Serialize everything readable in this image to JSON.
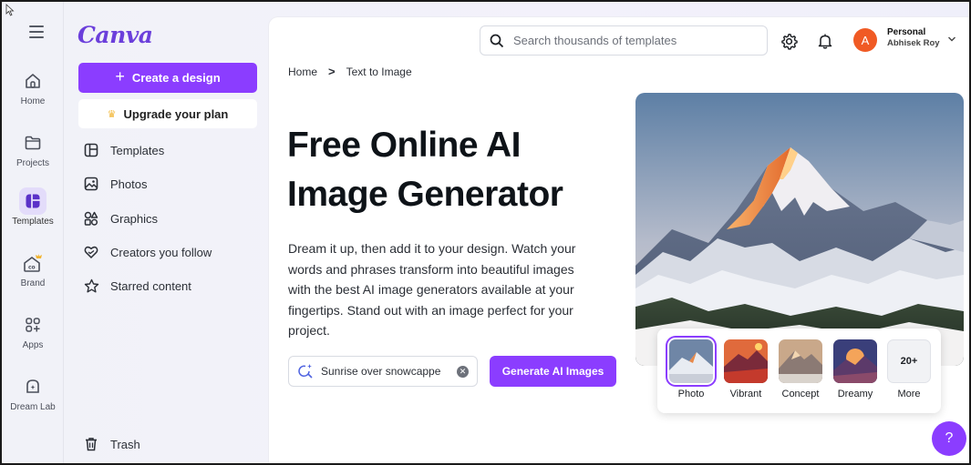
{
  "app": {
    "logo": "Canva"
  },
  "rail": {
    "items": [
      {
        "label": "Home",
        "icon": "home-icon"
      },
      {
        "label": "Projects",
        "icon": "folder-icon"
      },
      {
        "label": "Templates",
        "icon": "templates-icon",
        "active": true
      },
      {
        "label": "Brand",
        "icon": "brand-icon"
      },
      {
        "label": "Apps",
        "icon": "apps-icon"
      },
      {
        "label": "Dream Lab",
        "icon": "dream-lab-icon"
      }
    ]
  },
  "sidebar": {
    "create_label": "Create a design",
    "upgrade_label": "Upgrade your plan",
    "items": [
      {
        "label": "Templates",
        "icon": "templates-icon"
      },
      {
        "label": "Photos",
        "icon": "photos-icon"
      },
      {
        "label": "Graphics",
        "icon": "graphics-icon"
      },
      {
        "label": "Creators you follow",
        "icon": "heart-icon"
      },
      {
        "label": "Starred content",
        "icon": "star-icon"
      }
    ],
    "trash_label": "Trash"
  },
  "header": {
    "search_placeholder": "Search thousands of templates",
    "account_type": "Personal",
    "account_name": "Abhisek Roy",
    "avatar_initial": "A"
  },
  "breadcrumb": {
    "items": [
      "Home",
      "Text to Image"
    ],
    "separator": ">"
  },
  "hero": {
    "title_line1": "Free Online AI",
    "title_line2": "Image Generator",
    "description": "Dream it up, then add it to your design. Watch your words and phrases transform into beautiful images with the best AI image generators available at your fingertips. Stand out with an image perfect for your project.",
    "prompt_value": "Sunrise over snowcappe",
    "generate_label": "Generate AI Images"
  },
  "styles": {
    "items": [
      {
        "label": "Photo",
        "active": true
      },
      {
        "label": "Vibrant"
      },
      {
        "label": "Concept"
      },
      {
        "label": "Dreamy"
      }
    ],
    "more_count": "20+",
    "more_label": "More"
  },
  "help": {
    "label": "?"
  },
  "colors": {
    "accent": "#8b3dff",
    "avatar": "#f05a24",
    "crown": "#f2b532"
  }
}
